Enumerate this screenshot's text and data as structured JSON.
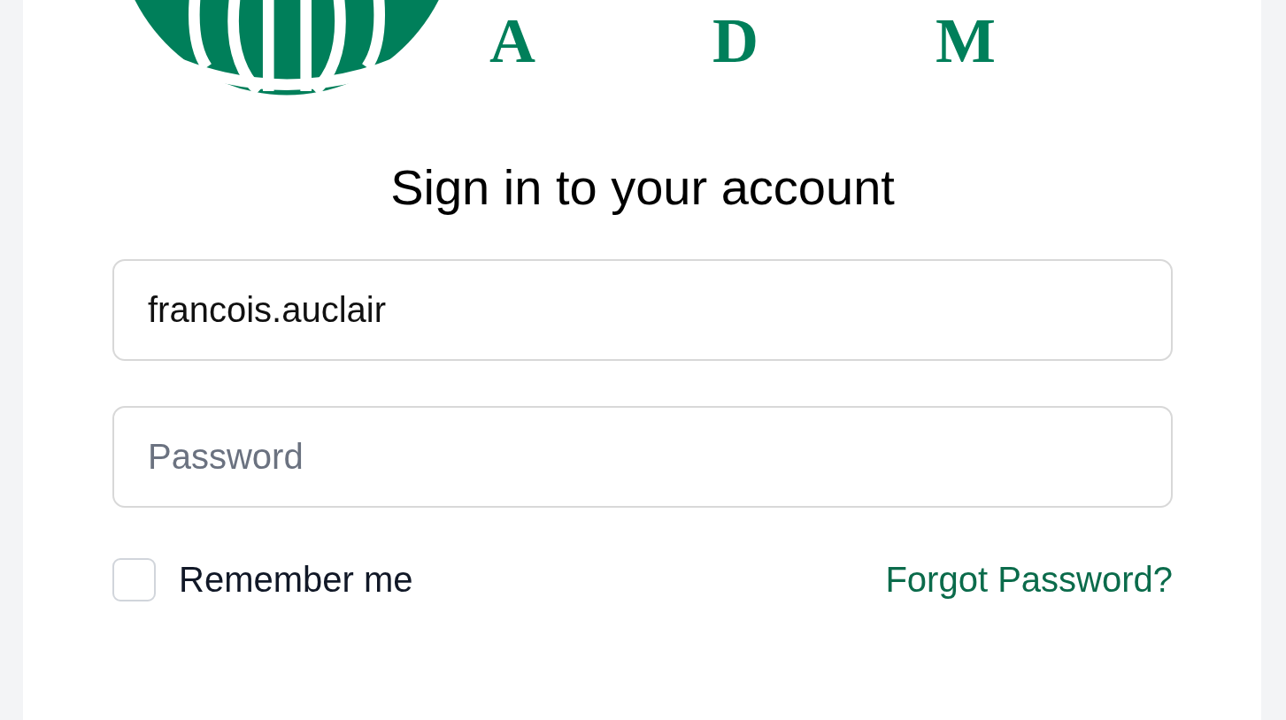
{
  "logo": {
    "text": "ADM"
  },
  "title": "Sign in to your account",
  "username": {
    "value": "francois.auclair"
  },
  "password": {
    "placeholder": "Password"
  },
  "remember": {
    "label": "Remember me",
    "checked": false
  },
  "forgot_link": "Forgot Password?"
}
